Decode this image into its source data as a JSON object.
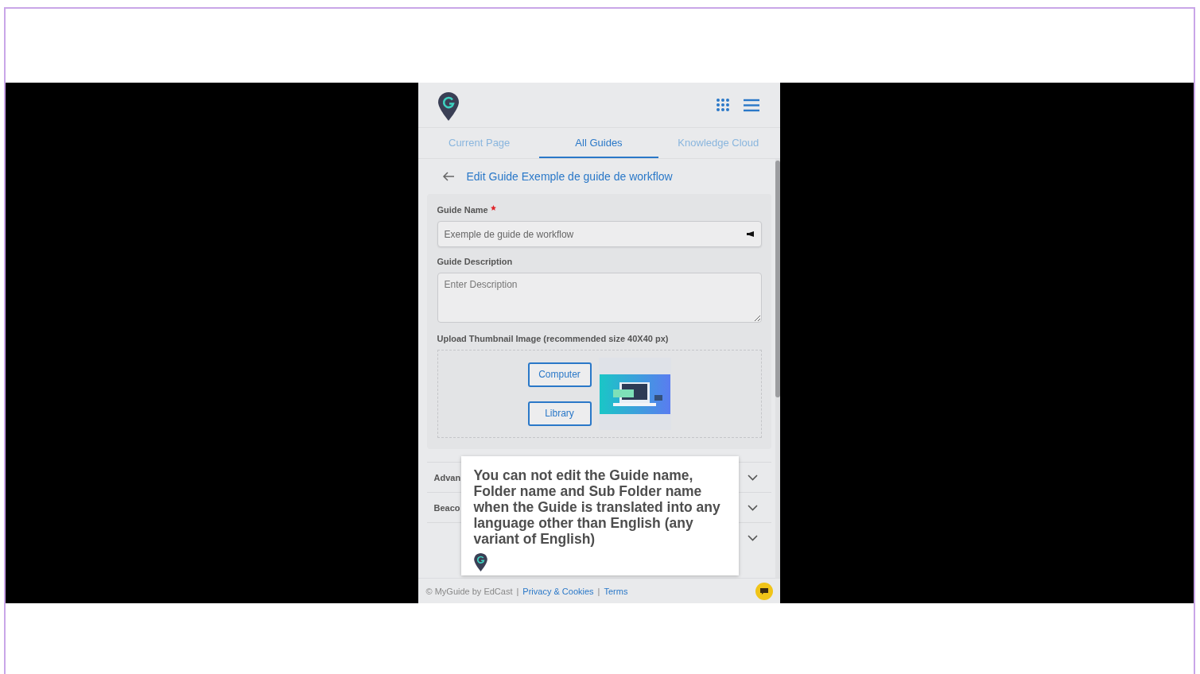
{
  "tabs": [
    {
      "label": "Current Page",
      "selected": false
    },
    {
      "label": "All Guides",
      "selected": true
    },
    {
      "label": "Knowledge Cloud",
      "selected": false
    }
  ],
  "page_title": "Edit Guide Exemple de guide de workflow",
  "form": {
    "name_label": "Guide Name",
    "name_required": true,
    "name_value": "Exemple de guide de workflow",
    "description_label": "Guide Description",
    "description_placeholder": "Enter Description",
    "upload_label": "Upload Thumbnail Image (recommended size 40X40 px)",
    "upload_buttons": [
      "Computer",
      "Library"
    ]
  },
  "accordion": [
    {
      "label": "Advan",
      "expanded": false
    },
    {
      "label": "Beaco",
      "expanded": false
    },
    {
      "expanded": false
    }
  ],
  "tooltip": {
    "text": "You can not edit the Guide name, Folder name and Sub Folder name when the Guide is translated into any language other than English (any variant of English)"
  },
  "footer": {
    "copyright": "© MyGuide by EdCast",
    "links": [
      {
        "separator": "|",
        "label": "Privacy & Cookies"
      },
      {
        "separator": "|",
        "label": "Terms"
      }
    ]
  }
}
